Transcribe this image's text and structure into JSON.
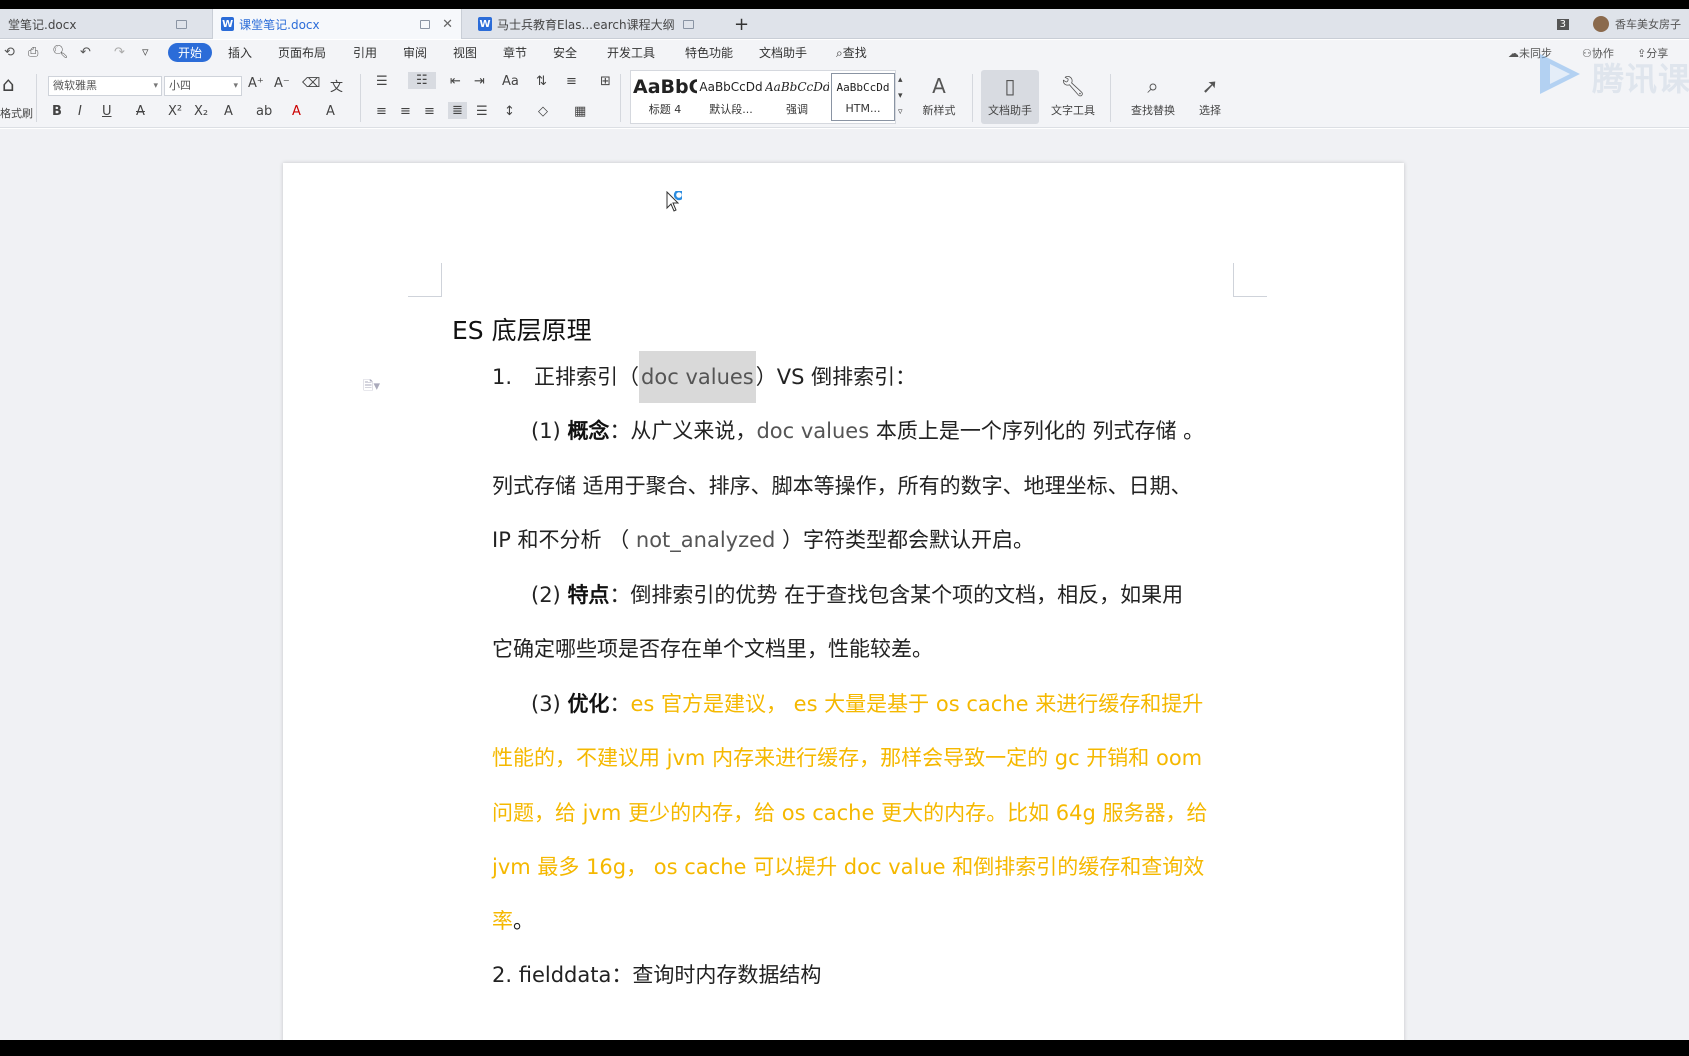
{
  "tabs": [
    {
      "label": "堂笔记.docx",
      "active": false
    },
    {
      "label": "课堂笔记.docx",
      "active": true
    },
    {
      "label": "马士兵教育Elas...earch课程大纲",
      "active": false
    }
  ],
  "tab_right": {
    "count": "3",
    "user": "香车美女房子"
  },
  "menu": {
    "items": [
      "开始",
      "插入",
      "页面布局",
      "引用",
      "审阅",
      "视图",
      "章节",
      "安全",
      "开发工具",
      "特色功能",
      "文档助手"
    ],
    "search": "查找",
    "right": [
      "未同步",
      "协作",
      "分享"
    ]
  },
  "ribbon": {
    "format_painter": "格式刷",
    "font_name": "微软雅黑",
    "font_size": "小四",
    "styles": [
      {
        "sample": "AaBbC",
        "name": "标题 4"
      },
      {
        "sample": "AaBbCcDd",
        "name": "默认段..."
      },
      {
        "sample": "AaBbCcDd",
        "name": "强调"
      },
      {
        "sample": "AaBbCcDd",
        "name": "HTM..."
      }
    ],
    "new_style": "新样式",
    "doc_assistant": "文档助手",
    "text_tools": "文字工具",
    "find_replace": "查找替换",
    "select": "选择"
  },
  "watermark": {
    "text": "腾讯课"
  },
  "document": {
    "title": "ES 底层原理",
    "h1_num": "1.",
    "h1_pre": "正排索引（",
    "h1_hl": "doc values",
    "h1_post": "）VS 倒排索引：",
    "p1_num": "(1)",
    "p1_label": "概念",
    "p1_a": "：从广义来说，",
    "p1_b": "doc values",
    "p1_c": " 本质上是一个序列化的 列式存储 。",
    "p1_line2": "列式存储 适用于聚合、排序、脚本等操作，所有的数字、地理坐标、日期、",
    "p1_line3a": "IP  和不分析 （",
    "p1_line3b": " not_analyzed ",
    "p1_line3c": "）字符类型都会默认开启。",
    "p2_num": "(2)",
    "p2_label": "特点",
    "p2_a": "：倒排索引的优势  在于查找包含某个项的文档，相反，如果用",
    "p2_line2": "它确定哪些项是否存在单个文档里，性能较差。",
    "p3_num": "(3)",
    "p3_label": "优化",
    "p3_a": "：",
    "p3_l1": "es 官方是建议， es 大量是基于 os cache 来进行缓存和提升",
    "p3_l2": "性能的，不建议用 jvm 内存来进行缓存，那样会导致一定的 gc 开销和 oom",
    "p3_l3": "问题，给 jvm 更少的内存，给 os cache 更大的内存。比如 64g 服务器，给",
    "p3_l4": "jvm 最多 16g， os cache 可以提升 doc value 和倒排索引的缓存和查询效",
    "p3_l5": "率",
    "p3_l5_end": "。",
    "h2": "2.    fielddata：查询时内存数据结构"
  },
  "colors": {
    "accent": "#2b6cd8",
    "highlight_text": "#f5b800",
    "selection": "#d9d9d9"
  }
}
